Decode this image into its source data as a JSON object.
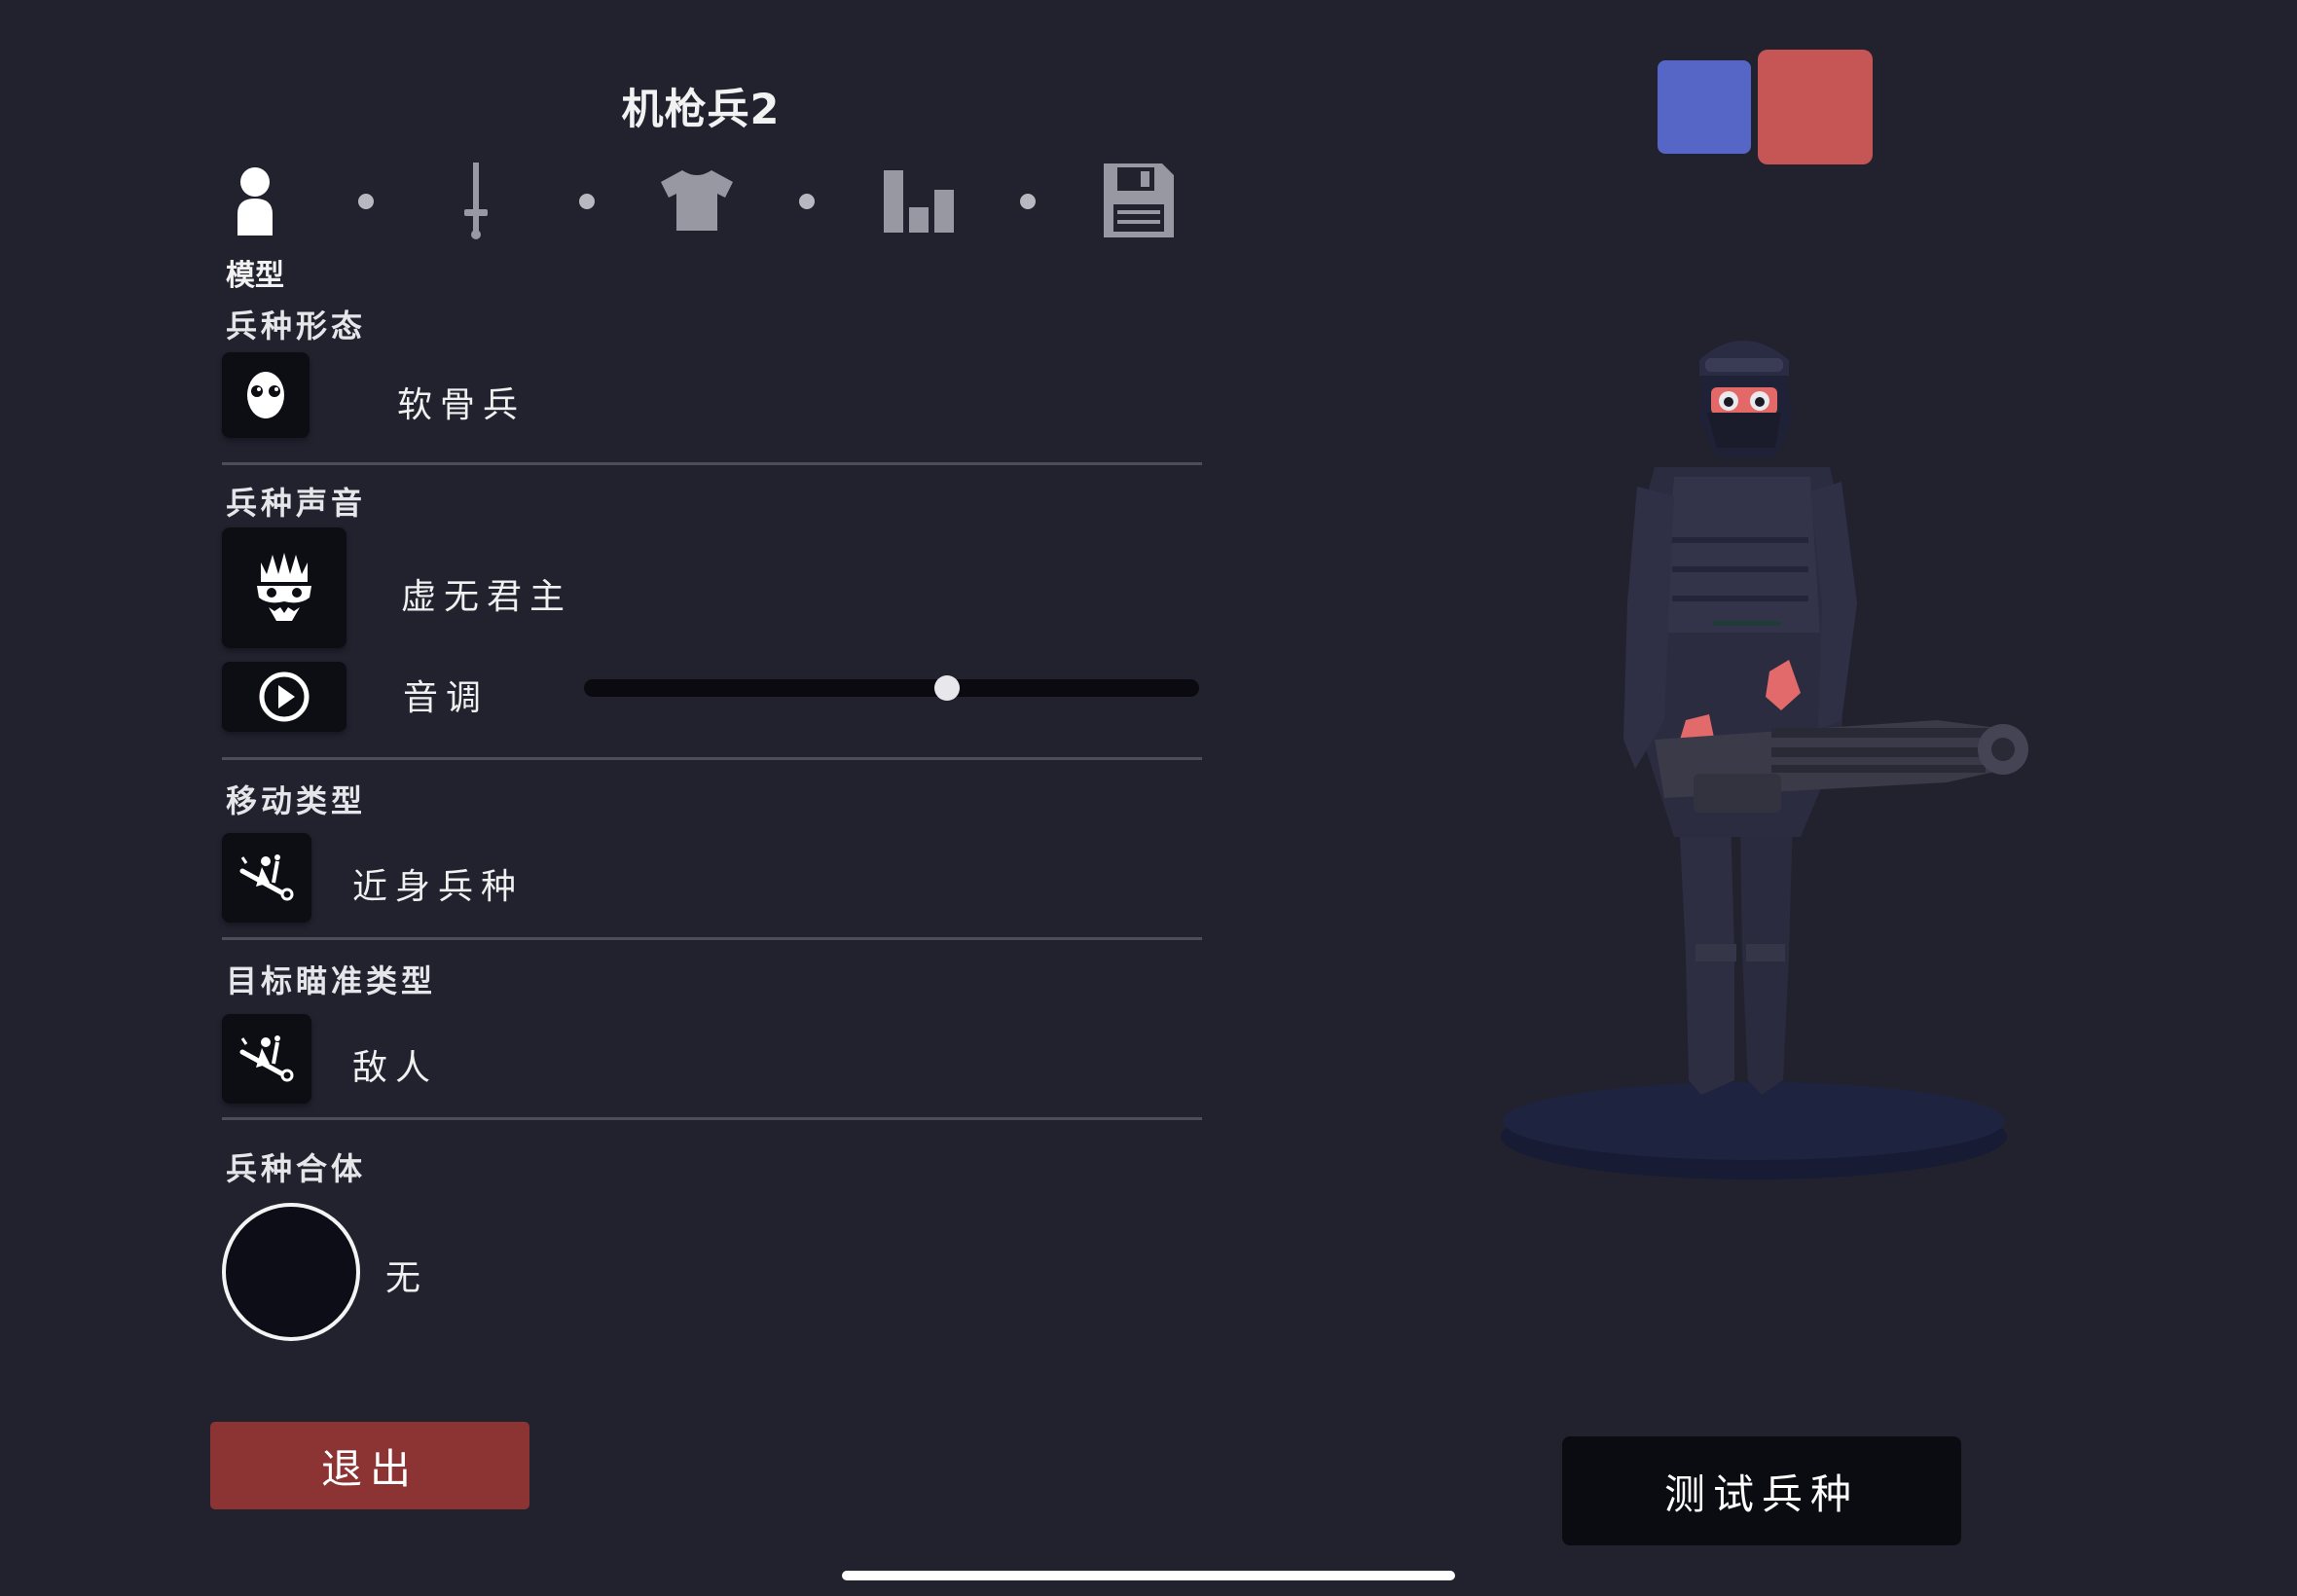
{
  "title": "机枪兵2",
  "tabs": [
    {
      "icon": "person-icon",
      "label": "模型",
      "active": true
    },
    {
      "icon": "sword-icon",
      "active": false
    },
    {
      "icon": "shirt-icon",
      "active": false
    },
    {
      "icon": "bar-chart-icon",
      "active": false
    },
    {
      "icon": "save-icon",
      "active": false
    }
  ],
  "sections": {
    "form": {
      "heading": "兵种形态",
      "value": "软骨兵",
      "icon": "skull-face-icon"
    },
    "voice": {
      "heading": "兵种声音",
      "value": "虚无君主",
      "icon": "crown-mask-icon",
      "pitch_label": "音调",
      "pitch_value": 0.59,
      "play_icon": "play-icon"
    },
    "movement": {
      "heading": "移动类型",
      "value": "近身兵种",
      "icon": "charge-icon"
    },
    "targeting": {
      "heading": "目标瞄准类型",
      "value": "敌人",
      "icon": "charge-icon"
    },
    "combine": {
      "heading": "兵种合体",
      "value": "无"
    }
  },
  "buttons": {
    "exit": "退出",
    "test": "测试兵种"
  },
  "team_colors": {
    "blue": "#5566c6",
    "red": "#c65555"
  },
  "colors": {
    "background": "#22222f",
    "tile": "#0d0d14",
    "exit": "#8c3333"
  }
}
